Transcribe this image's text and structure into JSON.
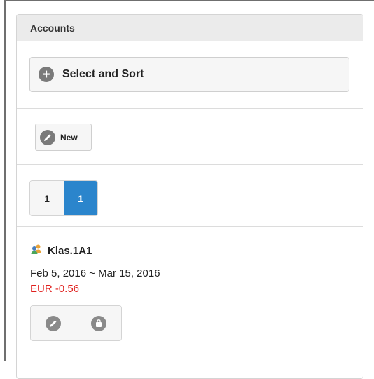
{
  "panel": {
    "title": "Accounts"
  },
  "select_sort": {
    "label": "Select and Sort",
    "icon": "plus-circle-icon"
  },
  "new_button": {
    "label": "New",
    "icon": "pencil-circle-icon"
  },
  "pagination": {
    "pages": [
      {
        "label": "1",
        "active": false
      },
      {
        "label": "1",
        "active": true
      }
    ]
  },
  "account": {
    "name": "Klas.1A1",
    "icon": "users-icon",
    "dates": "Feb 5, 2016 ~ Mar 15, 2016",
    "balance": "EUR -0.56",
    "actions": [
      {
        "icon": "pencil-circle-icon"
      },
      {
        "icon": "bag-circle-icon"
      }
    ]
  },
  "colors": {
    "active_page": "#2b85cc",
    "negative_balance": "#e0201e",
    "header_bg": "#ebebeb"
  }
}
